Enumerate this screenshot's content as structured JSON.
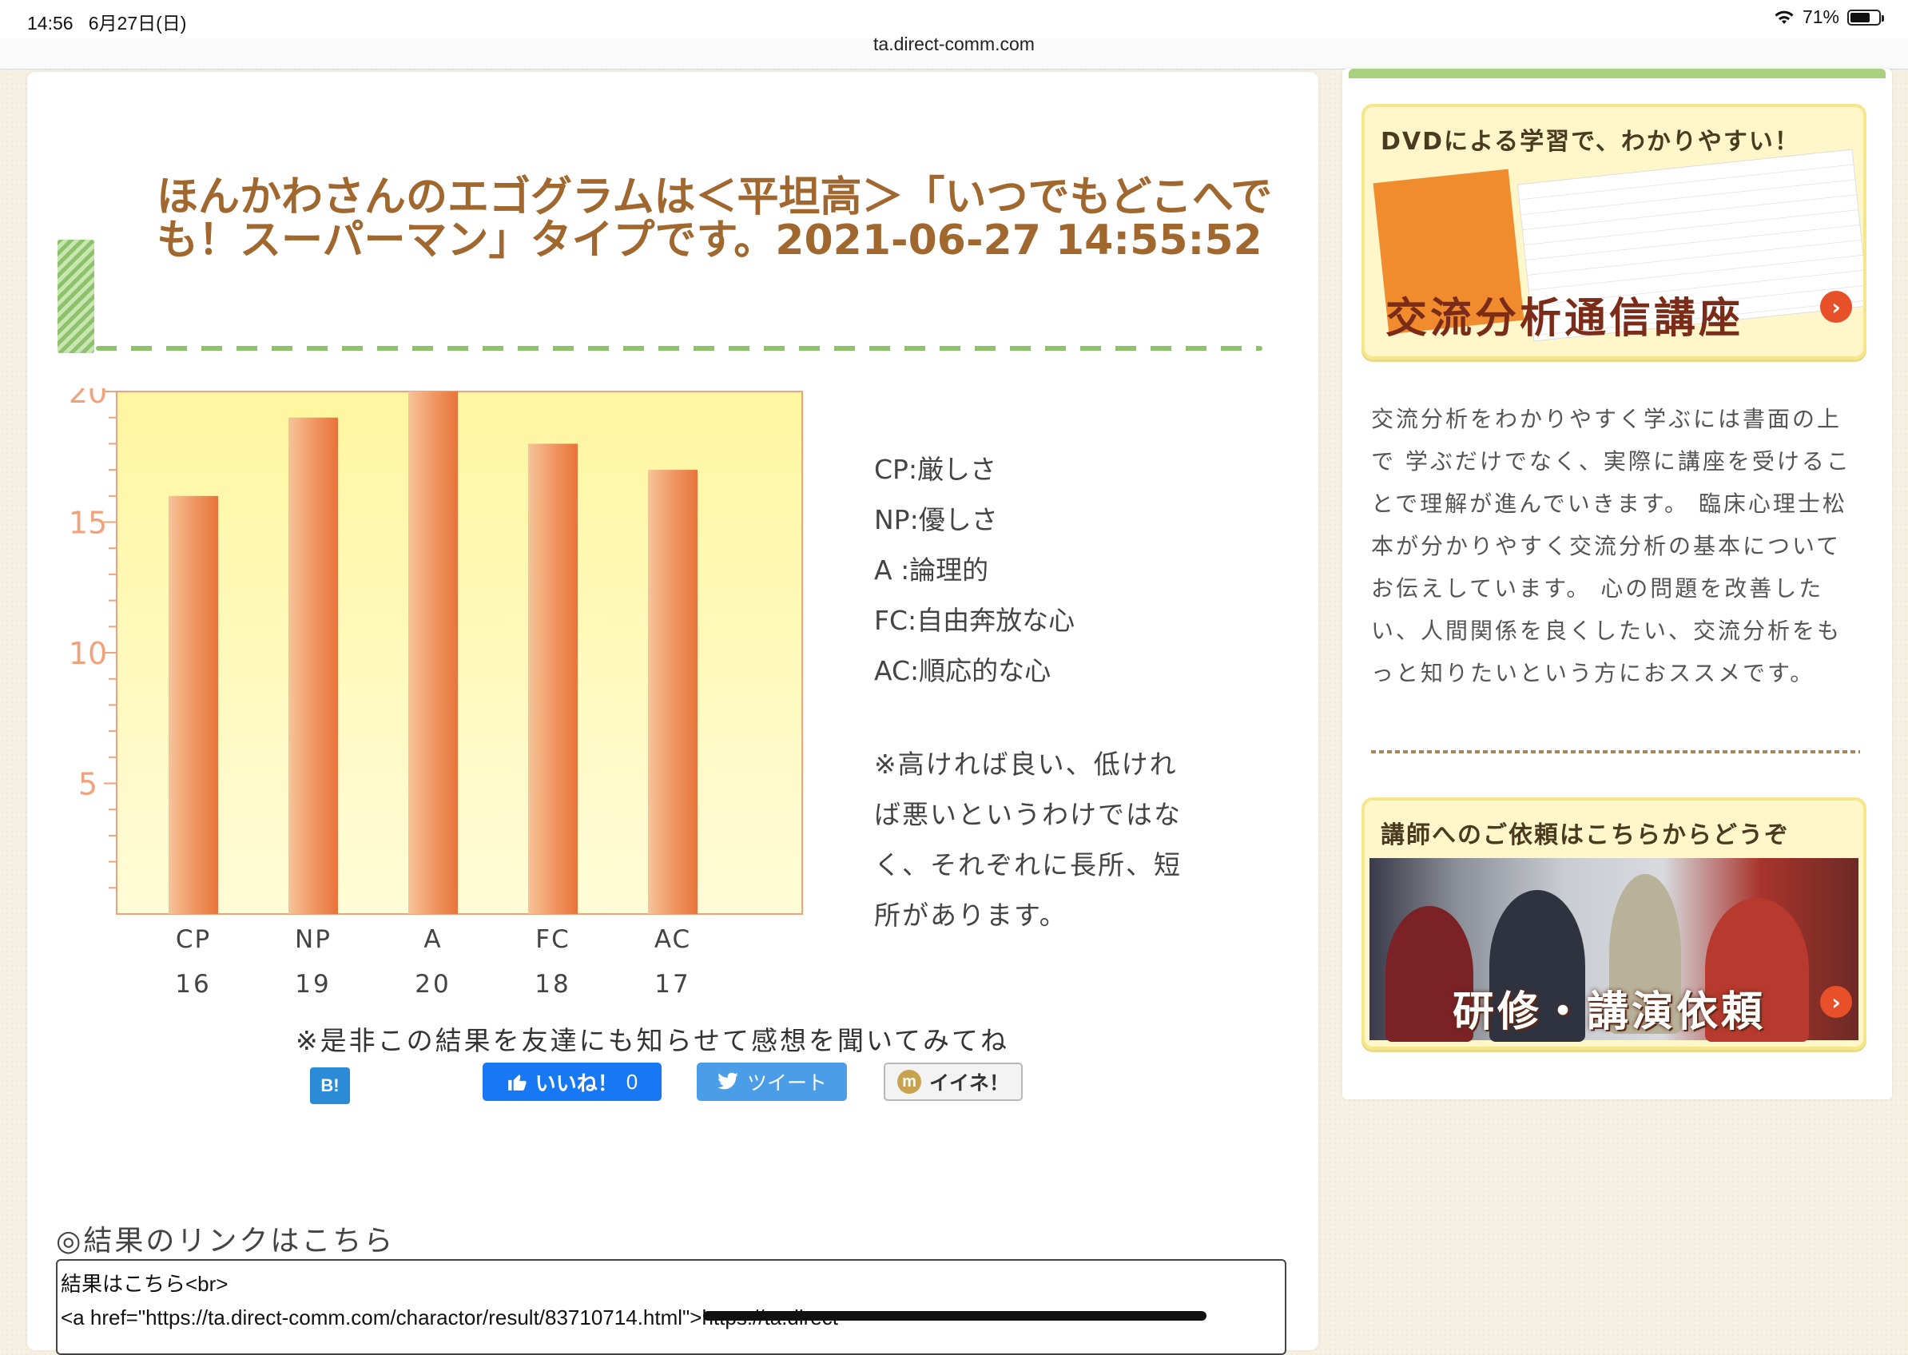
{
  "status_bar": {
    "time": "14:56",
    "date": "6月27日(日)",
    "battery": "71%",
    "battery_level": 0.71
  },
  "address_bar": {
    "url": "ta.direct-comm.com"
  },
  "page": {
    "title": "ほんかわさんのエゴグラムは＜平坦高＞「いつでもどこへでも！スーパーマン」タイプです。2021-06-27 14:55:52",
    "legend": [
      "CP:厳しさ",
      "NP:優しさ",
      "A :論理的",
      "FC:自由奔放な心",
      "AC:順応的な心"
    ],
    "note": "※高ければ良い、低ければ悪いというわけではなく、それぞれに長所、短所があります。",
    "share_caption": "※是非この結果を友達にも知らせて感想を聞いてみてね",
    "share_buttons": {
      "hatena": "B!",
      "facebook_label": "いいね！",
      "facebook_count": "0",
      "twitter": "ツイート",
      "mixi": "イイネ！"
    },
    "result_link_heading": "◎結果のリンクはこちら",
    "result_code_lines": [
      "結果はこちら<br>",
      "<a href=\"https://ta.direct-comm.com/charactor/result/83710714.html\">https://ta.direct-"
    ]
  },
  "chart_data": {
    "type": "bar",
    "categories": [
      "CP",
      "NP",
      "A",
      "FC",
      "AC"
    ],
    "values": [
      16,
      19,
      20,
      18,
      17
    ],
    "ylim": [
      0,
      20
    ],
    "yticks": [
      5,
      10,
      15,
      20
    ],
    "grid": false,
    "colors": {
      "bar": "#ee8a50",
      "background": "#fff9b8",
      "axis": "#f0a37a"
    }
  },
  "sidebar": {
    "banner1": {
      "top_text": "DVDによる学習で、わかりやすい！",
      "big_text": "交流分析通信講座"
    },
    "description": "交流分析をわかりやすく学ぶには書面の上で 学ぶだけでなく、実際に講座を受けることで理解が進んでいきます。 臨床心理士松本が分かりやすく交流分析の基本についてお伝えしています。 心の問題を改善したい、人間関係を良くしたい、交流分析をもっと知りたいという方におススメです。",
    "banner2": {
      "top_text": "講師へのご依頼はこちらからどうぞ",
      "big_text": "研修・講演依頼"
    }
  }
}
